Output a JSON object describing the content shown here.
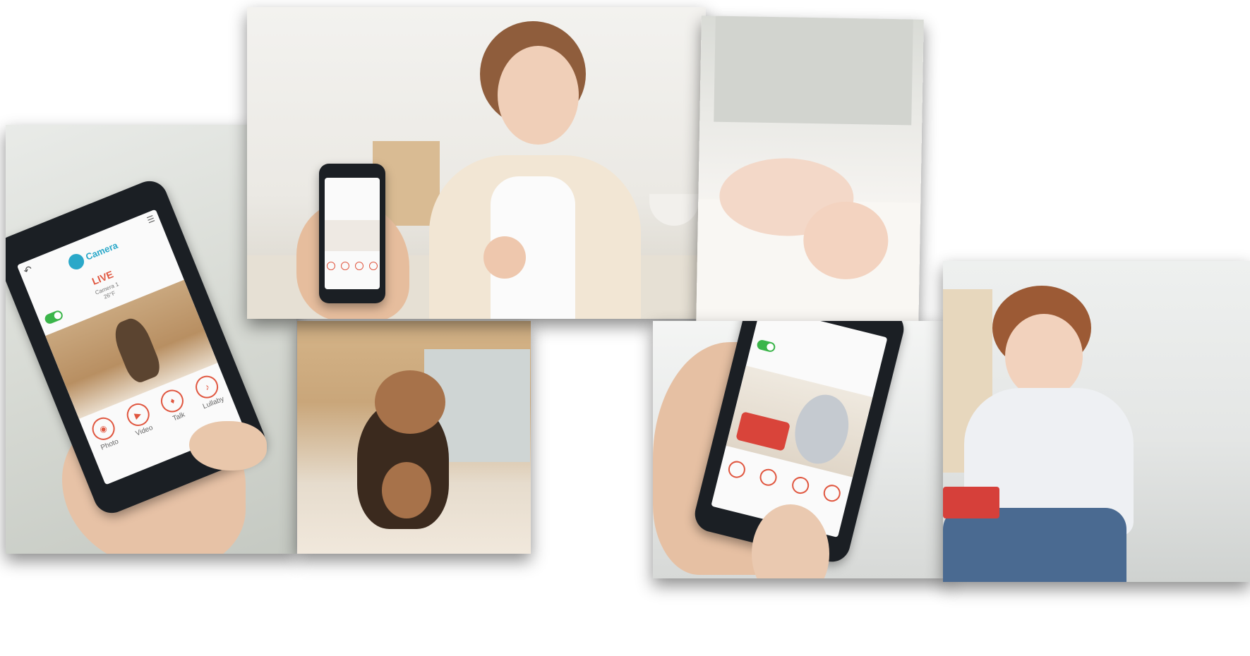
{
  "app": {
    "brand": "Camera",
    "live": "LIVE",
    "camera_name": "Camera 1",
    "temperature": "26°F"
  },
  "controls": [
    {
      "label": "Photo",
      "icon": "camera-icon"
    },
    {
      "label": "Video",
      "icon": "video-icon"
    },
    {
      "label": "Talk",
      "icon": "microphone-icon"
    },
    {
      "label": "Lullaby",
      "icon": "music-note-icon"
    }
  ],
  "colors": {
    "accent": "#e0563f",
    "brand": "#2aa8c9",
    "toggle_on": "#3bb54a",
    "phone_body": "#1b1f24"
  }
}
